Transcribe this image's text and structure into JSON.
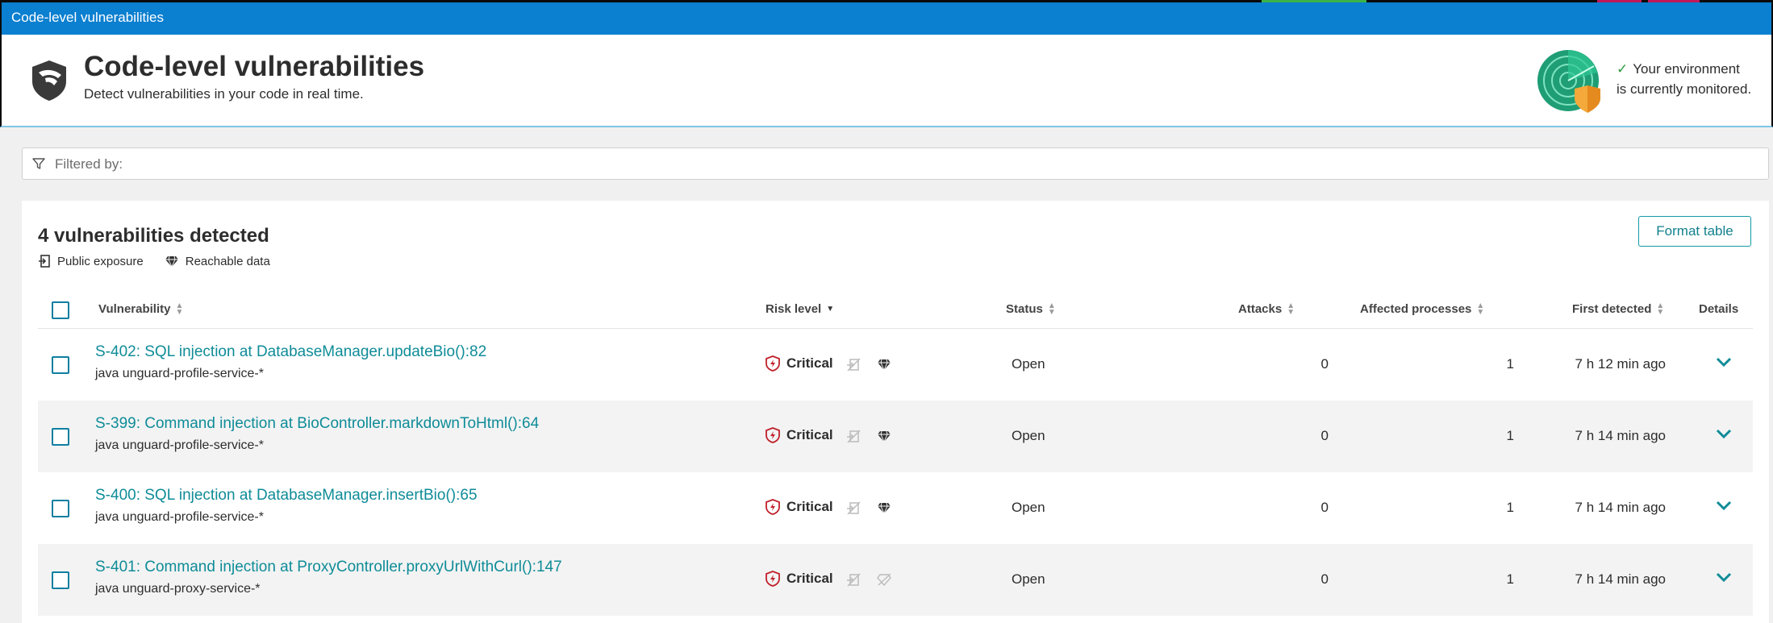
{
  "topbar": {
    "title": "Code-level vulnerabilities",
    "accent_colors": [
      "#3bb34a",
      "#c2185b",
      "#c2185b"
    ]
  },
  "header": {
    "title": "Code-level vulnerabilities",
    "subtitle": "Detect vulnerabilities in your code in real time.",
    "monitor_line1": "Your environment",
    "monitor_line2": "is currently monitored."
  },
  "filter": {
    "label": "Filtered by:"
  },
  "panel": {
    "heading": "4 vulnerabilities detected",
    "legend_public": "Public exposure",
    "legend_reachable": "Reachable data",
    "format_button": "Format table"
  },
  "table": {
    "columns": {
      "vulnerability": "Vulnerability",
      "risk": "Risk level",
      "status": "Status",
      "attacks": "Attacks",
      "affected": "Affected processes",
      "first": "First detected",
      "details": "Details"
    },
    "rows": [
      {
        "title": "S-402: SQL injection at DatabaseManager.updateBio():82",
        "process": "java unguard-profile-service-*",
        "risk": "Critical",
        "reachable_data": true,
        "status": "Open",
        "attacks": "0",
        "affected": "1",
        "first": "7 h 12 min ago"
      },
      {
        "title": "S-399: Command injection at BioController.markdownToHtml():64",
        "process": "java unguard-profile-service-*",
        "risk": "Critical",
        "reachable_data": true,
        "status": "Open",
        "attacks": "0",
        "affected": "1",
        "first": "7 h 14 min ago"
      },
      {
        "title": "S-400: SQL injection at DatabaseManager.insertBio():65",
        "process": "java unguard-profile-service-*",
        "risk": "Critical",
        "reachable_data": true,
        "status": "Open",
        "attacks": "0",
        "affected": "1",
        "first": "7 h 14 min ago"
      },
      {
        "title": "S-401: Command injection at ProxyController.proxyUrlWithCurl():147",
        "process": "java unguard-proxy-service-*",
        "risk": "Critical",
        "reachable_data": false,
        "status": "Open",
        "attacks": "0",
        "affected": "1",
        "first": "7 h 14 min ago"
      }
    ]
  },
  "colors": {
    "brand_blue": "#0b7fd0",
    "link_teal": "#0f8c98",
    "critical_red": "#c0202a",
    "check_green": "#2e9a3f"
  }
}
